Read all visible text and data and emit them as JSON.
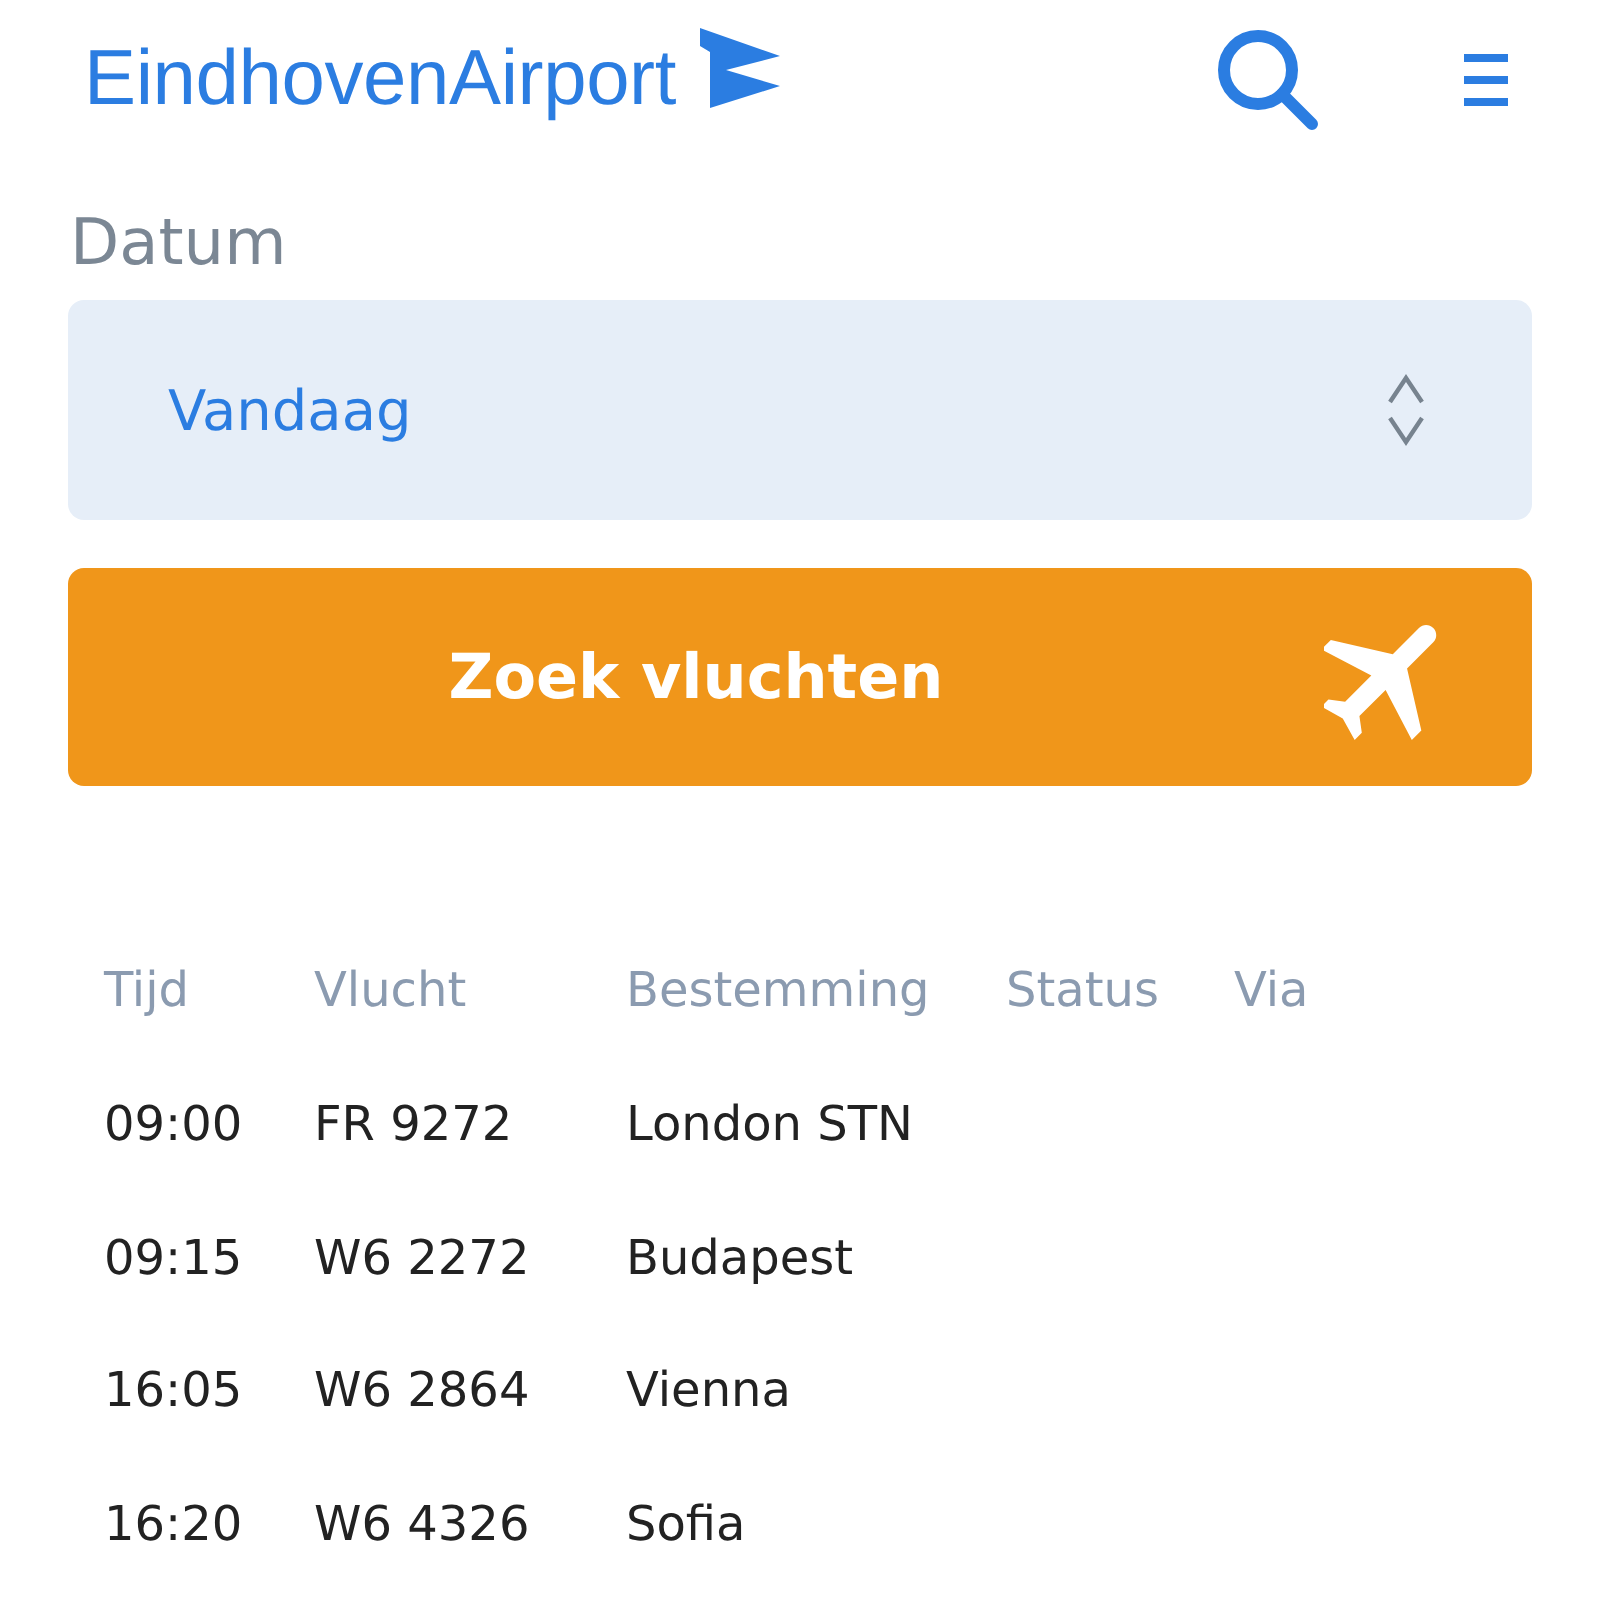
{
  "header": {
    "logo": "EindhovenAirport"
  },
  "date_field": {
    "label": "Datum",
    "value": "Vandaag"
  },
  "search_button": {
    "label": "Zoek vluchten"
  },
  "table": {
    "columns": [
      "Tijd",
      "Vlucht",
      "Bestemming",
      "Status",
      "Via"
    ],
    "rows": [
      [
        "09:00",
        "FR 9272",
        "London STN"
      ],
      [
        "09:15",
        "W6 2272",
        "Budapest"
      ],
      [
        "16:05",
        "W6 2864",
        "Vienna"
      ],
      [
        "16:20",
        "W6 4326",
        "Sofia"
      ]
    ]
  }
}
